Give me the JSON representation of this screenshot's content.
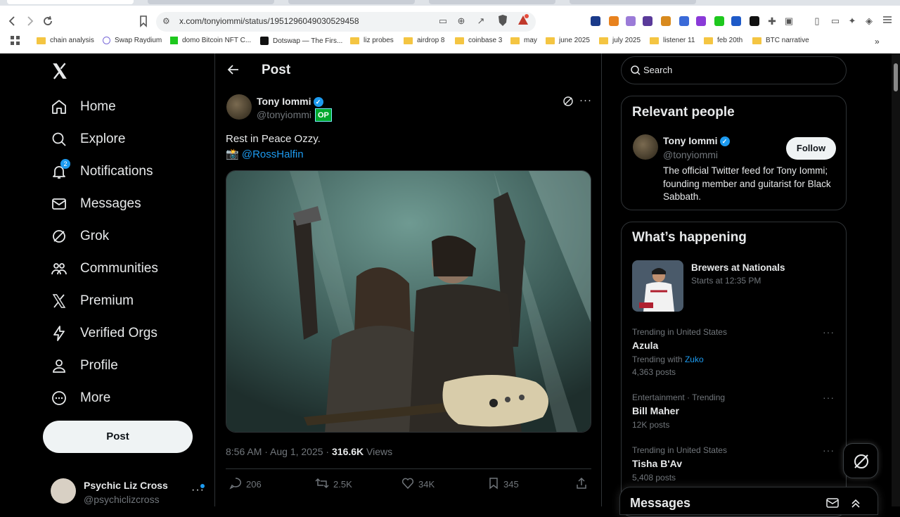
{
  "browser": {
    "url": "x.com/tonyiommi/status/1951296049030529458",
    "bookmarks": [
      "chain analysis",
      "Swap Raydium",
      "domo Bitcoin NFT C...",
      "Dotswap — The Firs...",
      "liz probes",
      "airdrop 8",
      "coinbase 3",
      "may",
      "june 2025",
      "july 2025",
      "listener 11",
      "feb 20th",
      "BTC narrative"
    ]
  },
  "nav": {
    "items": [
      {
        "label": "Home",
        "icon": "home-icon"
      },
      {
        "label": "Explore",
        "icon": "search-icon"
      },
      {
        "label": "Notifications",
        "icon": "bell-icon",
        "badge": "2"
      },
      {
        "label": "Messages",
        "icon": "mail-icon"
      },
      {
        "label": "Grok",
        "icon": "grok-icon"
      },
      {
        "label": "Communities",
        "icon": "communities-icon"
      },
      {
        "label": "Premium",
        "icon": "x-logo-icon"
      },
      {
        "label": "Verified Orgs",
        "icon": "lightning-icon"
      },
      {
        "label": "Profile",
        "icon": "person-icon"
      },
      {
        "label": "More",
        "icon": "more-circle-icon"
      }
    ],
    "post_button": "Post",
    "account": {
      "name": "Psychic Liz Cross",
      "handle": "@psychiclizcross"
    }
  },
  "post": {
    "header_title": "Post",
    "author_name": "Tony Iommi",
    "author_handle": "@tonyiommi",
    "op_badge": "OP",
    "text_line1": "Rest in Peace Ozzy.",
    "camera_emoji": "📸",
    "mention": "@RossHalfin",
    "timestamp": "8:56 AM · Aug 1, 2025 · ",
    "views_count": "316.6K",
    "views_label": " Views",
    "stats": {
      "replies": "206",
      "reposts": "2.5K",
      "likes": "34K",
      "bookmarks": "345"
    }
  },
  "search": {
    "placeholder": "Search"
  },
  "relevant_people": {
    "title": "Relevant people",
    "name": "Tony Iommi",
    "handle": "@tonyiommi",
    "follow_label": "Follow",
    "bio": "The official Twitter feed for Tony Iommi; founding member and guitarist for Black Sabbath."
  },
  "happening": {
    "title": "What’s happening",
    "event": {
      "title": "Brewers at Nationals",
      "subtitle": "Starts at 12:35 PM"
    },
    "trends": [
      {
        "context": "Trending in United States",
        "name": "Azula",
        "extra_prefix": "Trending with ",
        "extra_link": "Zuko",
        "posts": "4,363 posts"
      },
      {
        "context": "Entertainment · Trending",
        "name": "Bill Maher",
        "posts": "12K posts"
      },
      {
        "context": "Trending in United States",
        "name": "Tisha B'Av",
        "posts": "5,408 posts"
      }
    ]
  },
  "messages_drawer": {
    "title": "Messages"
  }
}
